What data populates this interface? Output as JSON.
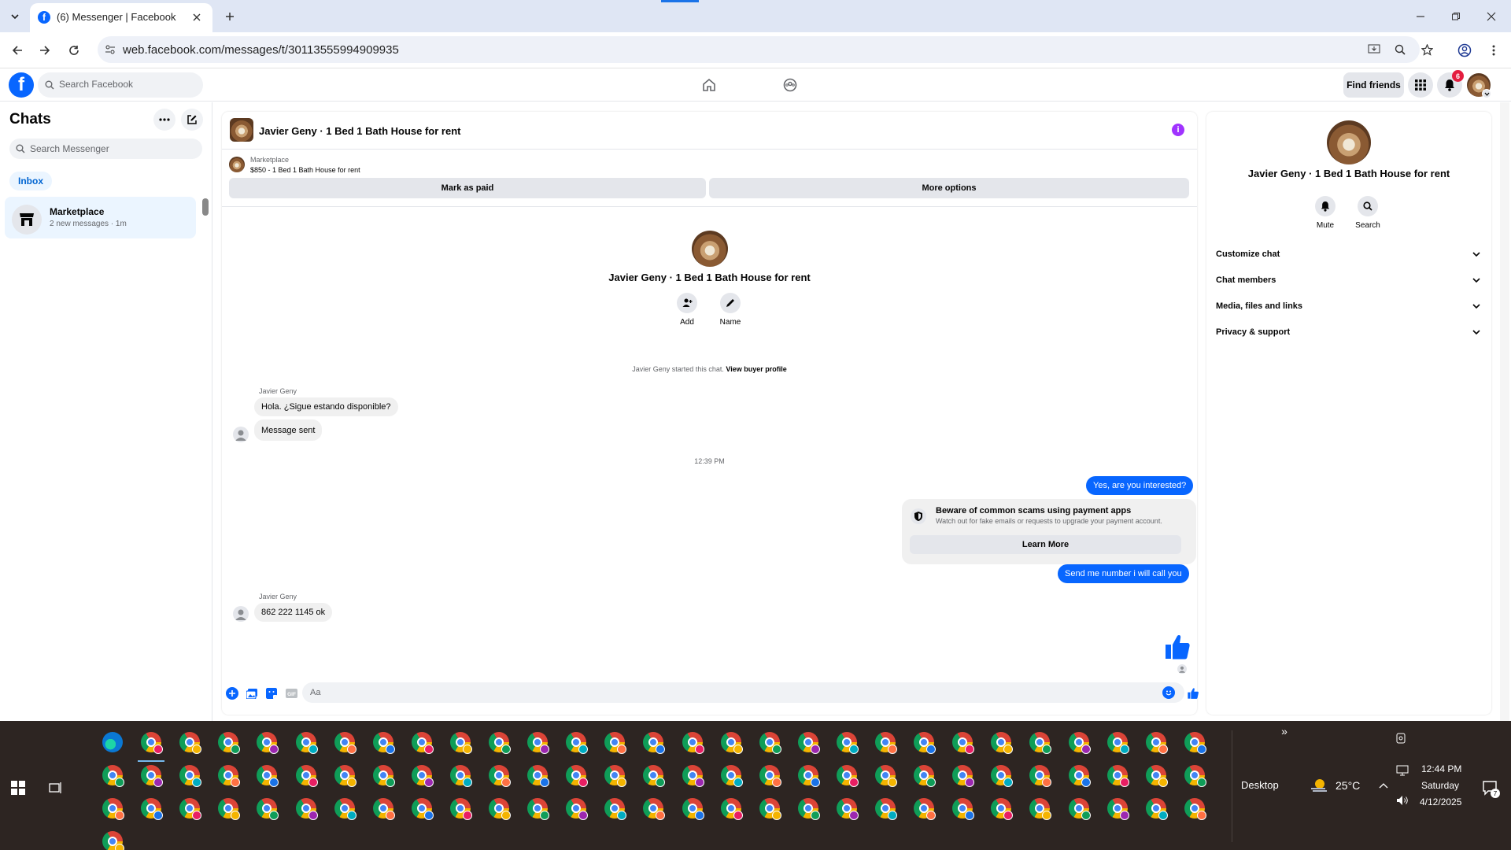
{
  "browser": {
    "tab_title": "(6) Messenger | Facebook",
    "url": "web.facebook.com/messages/t/30113555994909935"
  },
  "fb": {
    "search_placeholder": "Search Facebook",
    "find_friends": "Find friends",
    "notification_count": "6"
  },
  "sidebar": {
    "title": "Chats",
    "search_placeholder": "Search Messenger",
    "filter": "Inbox",
    "chats": [
      {
        "name": "Marketplace",
        "sub": "2 new messages · 1m"
      }
    ]
  },
  "conversation": {
    "title": "Javier Geny · 1 Bed 1 Bath House for rent",
    "marketplace_label": "Marketplace",
    "listing": "$850 - 1 Bed 1 Bath House for rent",
    "mark_paid": "Mark as paid",
    "more_options": "More options",
    "profile_name": "Javier Geny · 1 Bed 1 Bath House for rent",
    "add_label": "Add",
    "name_label": "Name",
    "started_text": "Javier Geny started this chat.",
    "view_buyer": "View buyer profile",
    "timestamp": "12:39 PM",
    "messages": [
      {
        "sender": "Javier Geny",
        "text": "Hola. ¿Sigue estando disponible?"
      },
      {
        "text": "Message sent"
      },
      {
        "out": true,
        "text": "Yes, are you interested?"
      },
      {
        "out": true,
        "text": "Send me number i will call you"
      },
      {
        "sender": "Javier Geny",
        "text": "862 222 1145 ok"
      }
    ],
    "scam_title": "Beware of common scams using payment apps",
    "scam_sub": "Watch out for fake emails or requests to upgrade your payment account.",
    "learn_more": "Learn More",
    "composer_placeholder": "Aa"
  },
  "info_panel": {
    "name": "Javier Geny · 1 Bed 1 Bath House for rent",
    "mute": "Mute",
    "search": "Search",
    "sections": [
      "Customize chat",
      "Chat members",
      "Media, files and links",
      "Privacy & support"
    ]
  },
  "taskbar": {
    "desktop": "Desktop",
    "temperature": "25°C",
    "time": "12:44 PM",
    "day": "Saturday",
    "date": "4/12/2025",
    "action_badge": "7"
  },
  "colors": {
    "accent": "#0866ff",
    "facebook_blue": "#0866ff",
    "info_icon": "#a033ff",
    "taskbar": "#2d2522"
  }
}
